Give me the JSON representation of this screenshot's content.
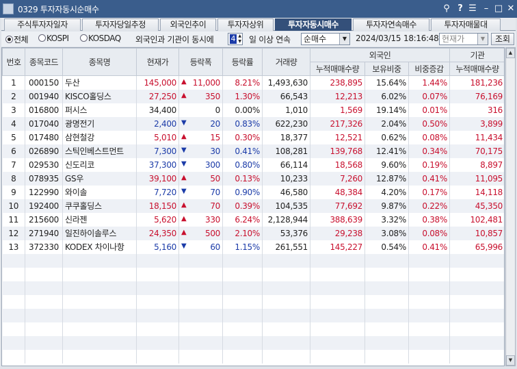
{
  "window": {
    "title": "0329 투자자동시순매수"
  },
  "title_buttons": [
    "pin-icon",
    "help-icon",
    "menu-icon",
    "minimize-icon",
    "maximize-icon",
    "close-icon"
  ],
  "tabs": [
    {
      "label": "주식투자자일자",
      "active": false
    },
    {
      "label": "투자자당일추정",
      "active": false
    },
    {
      "label": "외국인추이",
      "active": false
    },
    {
      "label": "투자자상위",
      "active": false
    },
    {
      "label": "투자자동시매수",
      "active": true
    },
    {
      "label": "투자자연속매수",
      "active": false
    },
    {
      "label": "투자자매물대",
      "active": false
    }
  ],
  "filter": {
    "market_options": [
      {
        "label": "전체",
        "selected": true
      },
      {
        "label": "KOSPI",
        "selected": false
      },
      {
        "label": "KOSDAQ",
        "selected": false
      }
    ],
    "condition_prefix": "외국인과 기관이 동시에",
    "days_value": "4",
    "condition_suffix": "일 이상 연속",
    "type_select": "순매수",
    "date": "2024/03/15",
    "time": "18:16:48",
    "price_select": "현재가",
    "query_button": "조회"
  },
  "table": {
    "headers": {
      "no": "번호",
      "code": "종목코드",
      "name": "종목명",
      "price": "현재가",
      "change": "등락폭",
      "rate": "등락률",
      "volume": "거래량",
      "foreign_group": "외국인",
      "f_cum": "누적매매수량",
      "f_hold": "보유비중",
      "f_delta": "비중증감",
      "inst_group": "기관",
      "i_cum": "누적매매수량"
    },
    "rows": [
      {
        "no": "1",
        "code": "000150",
        "name": "두산",
        "price": "145,000",
        "dir": "up",
        "change": "11,000",
        "rate": "8.21%",
        "volume": "1,493,630",
        "f_cum": "238,895",
        "f_hold": "15.64%",
        "f_delta": "1.44%",
        "i_cum": "181,236"
      },
      {
        "no": "2",
        "code": "001940",
        "name": "KISCO홀딩스",
        "price": "27,250",
        "dir": "up",
        "change": "350",
        "rate": "1.30%",
        "volume": "66,543",
        "f_cum": "12,213",
        "f_hold": "6.02%",
        "f_delta": "0.07%",
        "i_cum": "76,169"
      },
      {
        "no": "3",
        "code": "016800",
        "name": "퍼시스",
        "price": "34,400",
        "dir": "flat",
        "change": "0",
        "rate": "0.00%",
        "volume": "1,010",
        "f_cum": "1,569",
        "f_hold": "19.14%",
        "f_delta": "0.01%",
        "i_cum": "316"
      },
      {
        "no": "4",
        "code": "017040",
        "name": "광명전기",
        "price": "2,400",
        "dir": "down",
        "change": "20",
        "rate": "0.83%",
        "volume": "622,230",
        "f_cum": "217,326",
        "f_hold": "2.04%",
        "f_delta": "0.50%",
        "i_cum": "3,899"
      },
      {
        "no": "5",
        "code": "017480",
        "name": "삼현철강",
        "price": "5,010",
        "dir": "up",
        "change": "15",
        "rate": "0.30%",
        "volume": "18,377",
        "f_cum": "12,521",
        "f_hold": "0.62%",
        "f_delta": "0.08%",
        "i_cum": "11,434"
      },
      {
        "no": "6",
        "code": "026890",
        "name": "스틱인베스트먼트",
        "price": "7,300",
        "dir": "down",
        "change": "30",
        "rate": "0.41%",
        "volume": "108,281",
        "f_cum": "139,768",
        "f_hold": "12.41%",
        "f_delta": "0.34%",
        "i_cum": "70,175"
      },
      {
        "no": "7",
        "code": "029530",
        "name": "신도리코",
        "price": "37,300",
        "dir": "down",
        "change": "300",
        "rate": "0.80%",
        "volume": "66,114",
        "f_cum": "18,568",
        "f_hold": "9.60%",
        "f_delta": "0.19%",
        "i_cum": "8,897"
      },
      {
        "no": "8",
        "code": "078935",
        "name": "GS우",
        "price": "39,100",
        "dir": "up",
        "change": "50",
        "rate": "0.13%",
        "volume": "10,233",
        "f_cum": "7,260",
        "f_hold": "12.87%",
        "f_delta": "0.41%",
        "i_cum": "11,095"
      },
      {
        "no": "9",
        "code": "122990",
        "name": "와이솔",
        "price": "7,720",
        "dir": "down",
        "change": "70",
        "rate": "0.90%",
        "volume": "46,580",
        "f_cum": "48,384",
        "f_hold": "4.20%",
        "f_delta": "0.17%",
        "i_cum": "14,118"
      },
      {
        "no": "10",
        "code": "192400",
        "name": "쿠쿠홀딩스",
        "price": "18,150",
        "dir": "up",
        "change": "70",
        "rate": "0.39%",
        "volume": "104,535",
        "f_cum": "77,692",
        "f_hold": "9.87%",
        "f_delta": "0.22%",
        "i_cum": "45,350"
      },
      {
        "no": "11",
        "code": "215600",
        "name": "신라젠",
        "price": "5,620",
        "dir": "up",
        "change": "330",
        "rate": "6.24%",
        "volume": "2,128,944",
        "f_cum": "388,639",
        "f_hold": "3.32%",
        "f_delta": "0.38%",
        "i_cum": "102,481"
      },
      {
        "no": "12",
        "code": "271940",
        "name": "일진하이솔루스",
        "price": "24,350",
        "dir": "up",
        "change": "500",
        "rate": "2.10%",
        "volume": "53,376",
        "f_cum": "29,238",
        "f_hold": "3.08%",
        "f_delta": "0.08%",
        "i_cum": "10,857"
      },
      {
        "no": "13",
        "code": "372330",
        "name": "KODEX 차이나항",
        "price": "5,160",
        "dir": "down",
        "change": "60",
        "rate": "1.15%",
        "volume": "261,551",
        "f_cum": "145,227",
        "f_hold": "0.54%",
        "f_delta": "0.41%",
        "i_cum": "65,996"
      }
    ]
  },
  "colors": {
    "up": "#c8102e",
    "down": "#1b3ba8",
    "titlebar": "#3a5d8c",
    "active_tab": "#34507a"
  }
}
